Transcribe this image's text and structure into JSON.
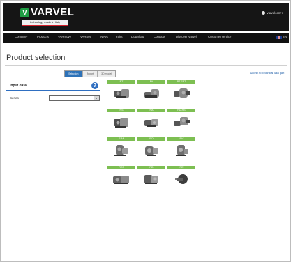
{
  "header": {
    "brand": "VARVEL",
    "logo_mark": "V",
    "tagline": "technology made in Italy",
    "user_label": "varvelcom"
  },
  "nav": {
    "items": [
      {
        "label": "Company"
      },
      {
        "label": "Products"
      },
      {
        "label": "VARmove"
      },
      {
        "label": "VARNet"
      },
      {
        "label": "News"
      },
      {
        "label": "Fairs"
      },
      {
        "label": "Download"
      },
      {
        "label": "Contacts"
      },
      {
        "label": "Discover Varvel"
      },
      {
        "label": "Customer service"
      }
    ],
    "language": "EN"
  },
  "page": {
    "title": "Product selection",
    "tabs": [
      {
        "label": "Selection",
        "active": true
      },
      {
        "label": "Report",
        "active": false
      },
      {
        "label": "3D model",
        "active": false
      }
    ],
    "right_link": "Access to Technical data part"
  },
  "input_panel": {
    "title": "Input data",
    "series_label": "Series",
    "series_value": ""
  },
  "products": [
    {
      "label": "RT",
      "icon": "gearbox-motor"
    },
    {
      "label": "FA",
      "icon": "gearbox-motor"
    },
    {
      "label": "RT-FRT",
      "icon": "gearbox-motor"
    },
    {
      "label": "RS",
      "icon": "gearbox-motor"
    },
    {
      "label": "RA",
      "icon": "gearbox-motor"
    },
    {
      "label": "RD-RS",
      "icon": "gearbox-motor"
    },
    {
      "label": "SRA",
      "icon": "gearbox-motor"
    },
    {
      "label": "RO",
      "icon": "gearbox-motor"
    },
    {
      "label": "RV",
      "icon": "gearbox-motor"
    },
    {
      "label": "RC3",
      "icon": "gearbox-motor"
    },
    {
      "label": "RD",
      "icon": "gearbox-motor"
    },
    {
      "label": "RE",
      "icon": "motor"
    }
  ],
  "colors": {
    "brand_green": "#1f9e44",
    "accent_blue": "#2f6fc1",
    "tile_green": "#7dbf52",
    "tagline_red": "#d21f2a"
  }
}
